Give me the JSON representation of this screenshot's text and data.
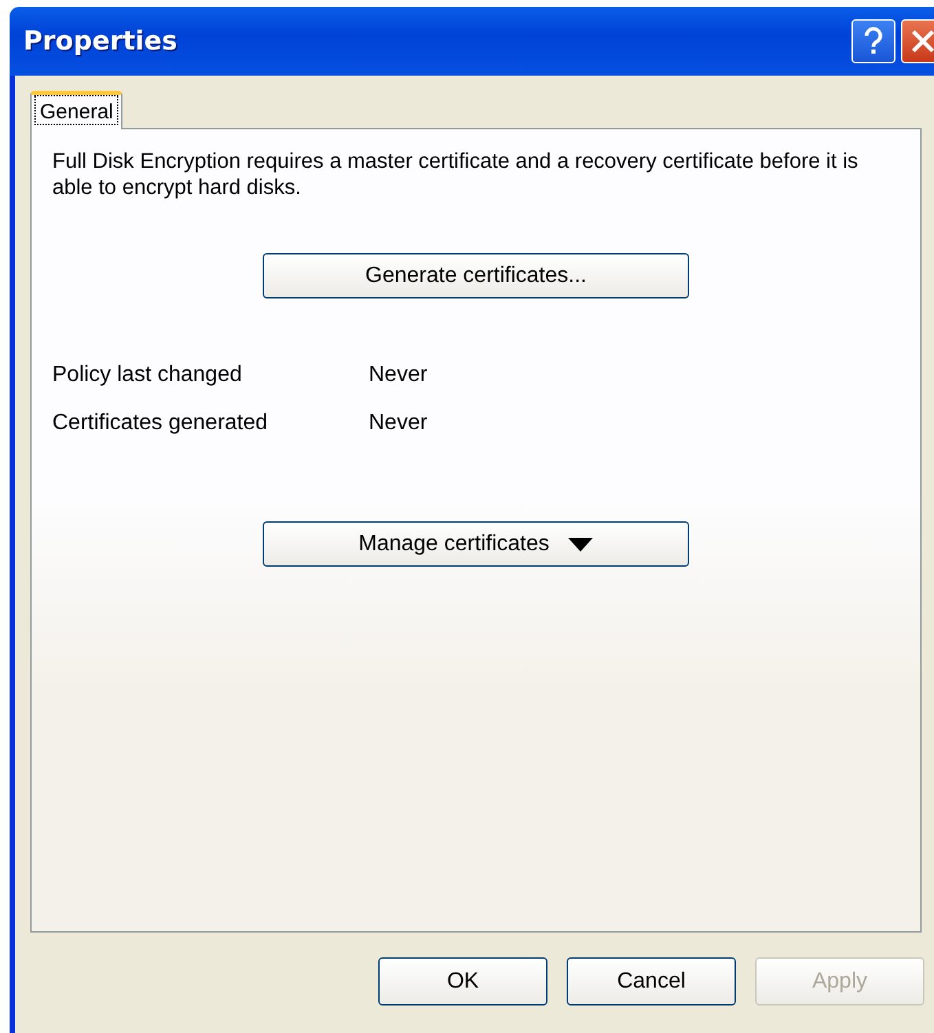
{
  "window": {
    "title": "Properties"
  },
  "tabs": [
    {
      "label": "General",
      "selected": true
    }
  ],
  "description": "Full Disk Encryption requires a master certificate and a recovery certificate before it is able to encrypt hard disks.",
  "generate_button": {
    "label": "Generate certificates..."
  },
  "info_rows": [
    {
      "label": "Policy last changed",
      "value": "Never"
    },
    {
      "label": "Certificates generated",
      "value": "Never"
    }
  ],
  "manage_button": {
    "label": "Manage certificates"
  },
  "buttons": [
    {
      "label": "OK",
      "disabled": false
    },
    {
      "label": "Cancel",
      "disabled": false
    },
    {
      "label": "Apply",
      "disabled": true
    }
  ]
}
